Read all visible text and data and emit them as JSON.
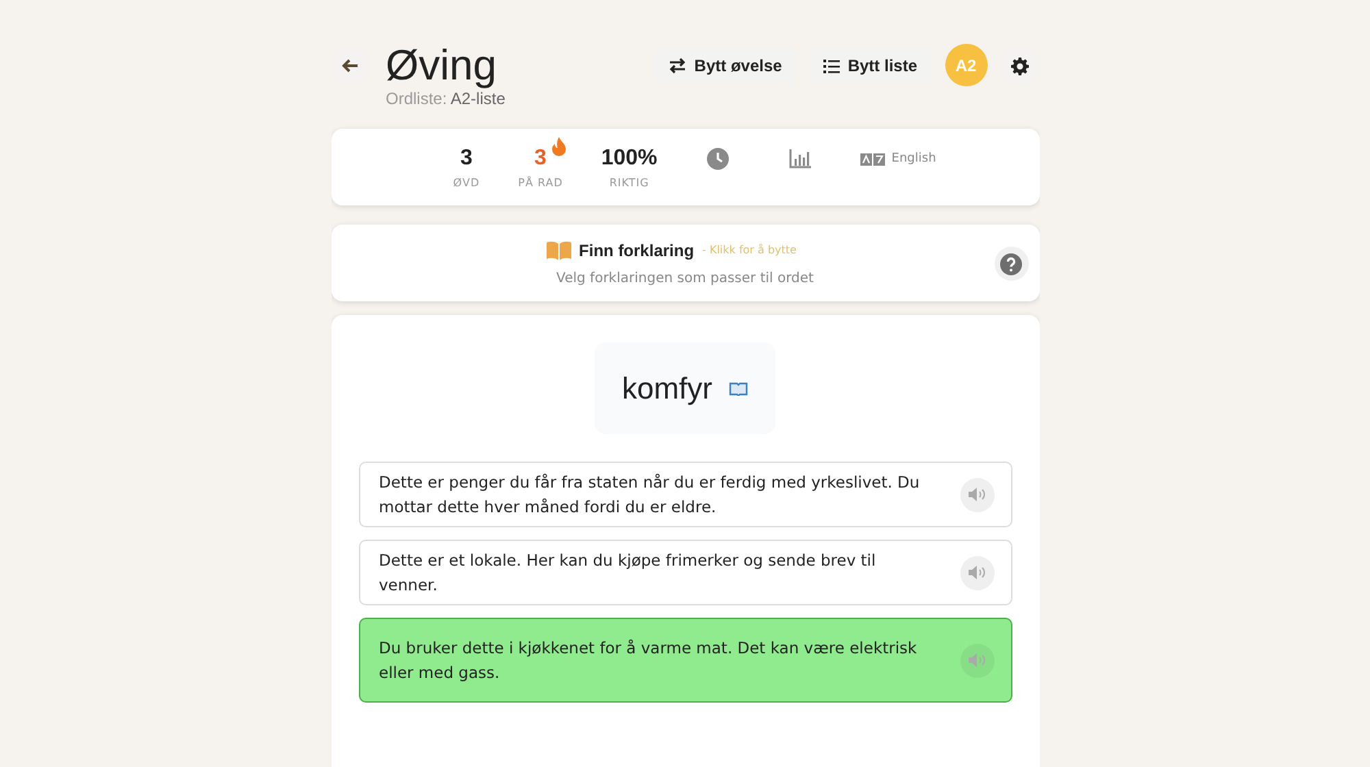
{
  "header": {
    "title": "Øving",
    "subtitle_label": "Ordliste:",
    "subtitle_value": "A2-liste",
    "buttons": [
      {
        "label": "Bytt øvelse",
        "kind": "swap"
      },
      {
        "label": "Bytt liste",
        "kind": "list"
      }
    ],
    "avatar": "A2"
  },
  "stats": [
    {
      "value": "3",
      "label": "ØVD",
      "kind": "plain"
    },
    {
      "value": "3",
      "label": "PÅ RAD",
      "kind": "streak"
    },
    {
      "value": "100%",
      "label": "RIKTIG",
      "kind": "plain"
    }
  ],
  "language": "English",
  "mode": {
    "title": "Finn forklaring",
    "hint": "- Klikk for å bytte",
    "instruction": "Velg forklaringen som passer til ordet"
  },
  "word": "komfyr",
  "options": [
    {
      "text": "Dette er penger du får fra staten når du er ferdig med yrkeslivet. Du mottar dette hver måned fordi du er eldre.",
      "correct": false
    },
    {
      "text": "Dette er et lokale. Her kan du kjøpe frimerker og sende brev til venner.",
      "correct": false
    },
    {
      "text": "Du bruker dette i kjøkkenet for å varme mat. Det kan være elektrisk eller med gass.",
      "correct": true
    }
  ]
}
